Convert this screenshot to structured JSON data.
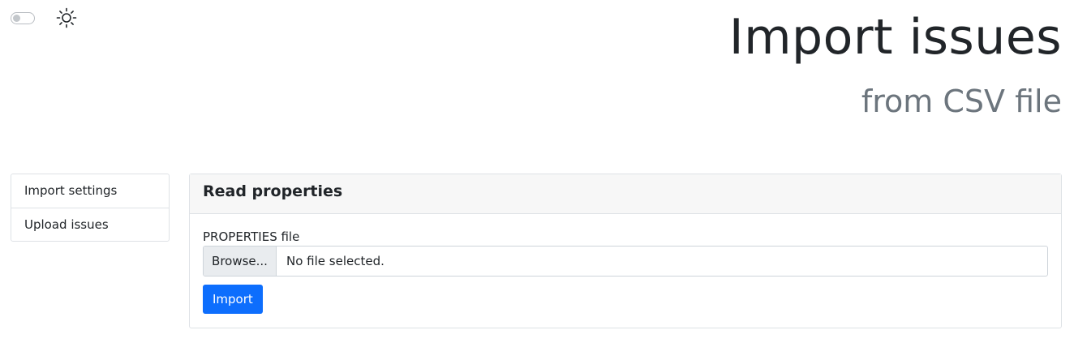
{
  "header": {
    "title": "Import issues",
    "subtitle": "from CSV file"
  },
  "toolbar": {
    "theme_toggle_state": "off",
    "theme_icon": "sun-icon"
  },
  "sidebar": {
    "items": [
      {
        "label": "Import settings"
      },
      {
        "label": "Upload issues"
      }
    ]
  },
  "card": {
    "title": "Read properties",
    "field_label": "PROPERTIES file",
    "browse_label": "Browse...",
    "file_status": "No file selected.",
    "submit_label": "Import"
  },
  "colors": {
    "primary": "#0d6efd",
    "muted": "#6c757d",
    "border": "#dee2e6"
  }
}
